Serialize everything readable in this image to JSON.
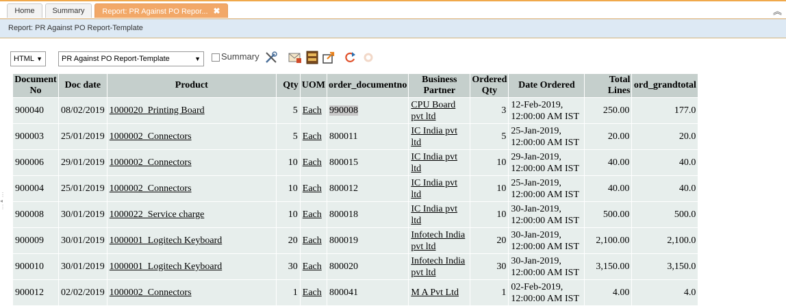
{
  "tabs": [
    {
      "label": "Home"
    },
    {
      "label": "Summary"
    },
    {
      "label": "Report: PR Against PO Repor...",
      "close": "✖"
    }
  ],
  "subheader": "Report: PR Against PO Report-Template",
  "toolbar": {
    "format_value": "HTML",
    "template_value": "PR Against PO Report-Template",
    "summary_label": "Summary"
  },
  "table": {
    "headers": [
      "Document No",
      "Doc date",
      "Product",
      "Qty",
      "UOM",
      "order_documentno",
      "Business Partner",
      "Ordered Qty",
      "Date Ordered",
      "Total Lines",
      "ord_grandtotal"
    ],
    "rows": [
      [
        "900040",
        "08/02/2019",
        "1000020_Printing Board",
        "5",
        "Each",
        "990008",
        "CPU Board pvt ltd",
        "3",
        "12-Feb-2019, 12:00:00 AM IST",
        "250.00",
        "177.0"
      ],
      [
        "900003",
        "25/01/2019",
        "1000002_Connectors",
        "5",
        "Each",
        "800011",
        "IC India pvt ltd",
        "5",
        "25-Jan-2019, 12:00:00 AM IST",
        "20.00",
        "20.0"
      ],
      [
        "900006",
        "29/01/2019",
        "1000002_Connectors",
        "10",
        "Each",
        "800015",
        "IC India pvt ltd",
        "10",
        "29-Jan-2019, 12:00:00 AM IST",
        "40.00",
        "40.0"
      ],
      [
        "900004",
        "25/01/2019",
        "1000002_Connectors",
        "10",
        "Each",
        "800012",
        "IC India pvt ltd",
        "10",
        "25-Jan-2019, 12:00:00 AM IST",
        "40.00",
        "40.0"
      ],
      [
        "900008",
        "30/01/2019",
        "1000022_Service charge",
        "10",
        "Each",
        "800018",
        "IC India pvt ltd",
        "10",
        "30-Jan-2019, 12:00:00 AM IST",
        "500.00",
        "500.0"
      ],
      [
        "900009",
        "30/01/2019",
        "1000001_Logitech Keyboard",
        "20",
        "Each",
        "800019",
        "Infotech India pvt ltd",
        "20",
        "30-Jan-2019, 12:00:00 AM IST",
        "2,100.00",
        "2,100.0"
      ],
      [
        "900010",
        "30/01/2019",
        "1000001_Logitech Keyboard",
        "30",
        "Each",
        "800020",
        "Infotech India pvt ltd",
        "30",
        "30-Jan-2019, 12:00:00 AM IST",
        "3,150.00",
        "3,150.0"
      ],
      [
        "900012",
        "02/02/2019",
        "1000002_Connectors",
        "1",
        "Each",
        "800041",
        "M A Pvt Ltd",
        "1",
        "02-Feb-2019, 12:00:00 AM IST",
        "4.00",
        "4.0"
      ]
    ]
  }
}
